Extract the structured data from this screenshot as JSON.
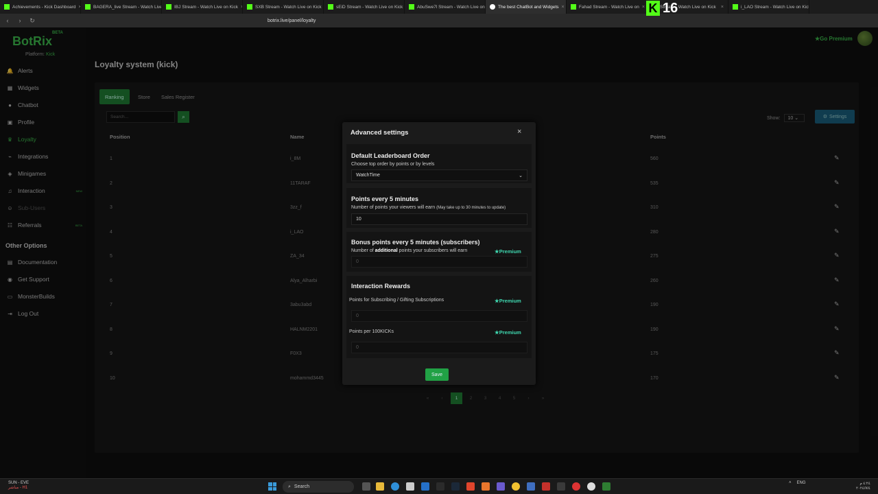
{
  "browser": {
    "tabs": [
      {
        "label": "Achievements - Kick Dashboard",
        "active": false
      },
      {
        "label": "BAGERA_live Stream - Watch Live",
        "active": false
      },
      {
        "label": "IBJ Stream - Watch Live on Kick",
        "active": false
      },
      {
        "label": "SXB Stream - Watch Live on Kick",
        "active": false
      },
      {
        "label": "sEiD Stream - Watch Live on Kick",
        "active": false
      },
      {
        "label": "AbuSwe7l Stream - Watch Live on",
        "active": false
      },
      {
        "label": "The best ChatBot and Widgets",
        "active": true
      },
      {
        "label": "Fahad Stream - Watch Live on",
        "active": false
      },
      {
        "label": "Stream - Watch Live on Kick",
        "active": false
      },
      {
        "label": "i_LAO Stream - Watch Live on Kick",
        "active": false
      }
    ],
    "url": "botrix.live/panel/loyalty",
    "overlay_badge": "16"
  },
  "app": {
    "logo": "BotRix",
    "logo_beta": "BETA",
    "platform_label": "Platform:",
    "platform_value": "Kick",
    "go_premium": "Go Premium",
    "nav": [
      {
        "label": "Alerts",
        "icon": "bell-icon",
        "state": "normal",
        "tag": ""
      },
      {
        "label": "Widgets",
        "icon": "widget-icon",
        "state": "normal",
        "tag": ""
      },
      {
        "label": "Chatbot",
        "icon": "chat-icon",
        "state": "normal",
        "tag": ""
      },
      {
        "label": "Profile",
        "icon": "profile-icon",
        "state": "normal",
        "tag": ""
      },
      {
        "label": "Loyalty",
        "icon": "trophy-icon",
        "state": "active",
        "tag": ""
      },
      {
        "label": "Integrations",
        "icon": "plug-icon",
        "state": "normal",
        "tag": ""
      },
      {
        "label": "Minigames",
        "icon": "gamepad-icon",
        "state": "normal",
        "tag": ""
      },
      {
        "label": "Interaction",
        "icon": "music-icon",
        "state": "normal",
        "tag": "NEW"
      },
      {
        "label": "Sub-Users",
        "icon": "users-icon",
        "state": "disabled",
        "tag": ""
      },
      {
        "label": "Referrals",
        "icon": "referral-icon",
        "state": "normal",
        "tag": "BETA"
      }
    ],
    "other_heading": "Other Options",
    "other": [
      {
        "label": "Documentation",
        "icon": "book-icon"
      },
      {
        "label": "Get Support",
        "icon": "support-icon"
      },
      {
        "label": "MonsterBuilds",
        "icon": "monitor-icon"
      },
      {
        "label": "Log Out",
        "icon": "logout-icon"
      }
    ]
  },
  "loyalty": {
    "title": "Loyalty system (kick)",
    "tabs": [
      "Ranking",
      "Store",
      "Sales Register"
    ],
    "search_placeholder": "Search...",
    "show_label": "Show:",
    "show_value": "10",
    "settings_label": "Settings",
    "columns": [
      "Position",
      "Name",
      "Points"
    ],
    "rows": [
      {
        "pos": "1",
        "name": "i_8M",
        "points": "560"
      },
      {
        "pos": "2",
        "name": "11TARAF",
        "points": "535"
      },
      {
        "pos": "3",
        "name": "3zz_f",
        "points": "310"
      },
      {
        "pos": "4",
        "name": "i_LAO",
        "points": "280"
      },
      {
        "pos": "5",
        "name": "ZA_34",
        "points": "275"
      },
      {
        "pos": "6",
        "name": "Alya_Alharbi",
        "points": "260"
      },
      {
        "pos": "7",
        "name": "3abu3abd",
        "points": "190"
      },
      {
        "pos": "8",
        "name": "HALNM2201",
        "points": "190"
      },
      {
        "pos": "9",
        "name": "F0X3",
        "points": "175"
      },
      {
        "pos": "10",
        "name": "mohammd3445",
        "points": "170"
      }
    ],
    "pagination": [
      "«",
      "‹",
      "1",
      "2",
      "3",
      "4",
      "5",
      "›",
      "»"
    ],
    "current_page": "1"
  },
  "modal": {
    "title": "Advanced settings",
    "close": "×",
    "leaderboard_heading": "Default Leaderboard Order",
    "leaderboard_desc": "Choose top order by points or by levels",
    "leaderboard_value": "WatchTime",
    "points_heading": "Points every 5 minutes",
    "points_desc": "Number of points your viewers will earn",
    "points_note": "(May take up to 30 minutes to update)",
    "points_value": "10",
    "bonus_heading": "Bonus points every 5 minutes (subscribers)",
    "bonus_desc_pre": "Number of",
    "bonus_desc_bold": "additional",
    "bonus_desc_post": "points your subscribers will earn",
    "bonus_value": "0",
    "premium_label": "Premium",
    "rewards_heading": "Interaction Rewards",
    "subs_label": "Points for Subscribing / Gifting Subscriptions",
    "subs_value": "0",
    "kicks_label": "Points per 100KICKs",
    "kicks_value": "0",
    "save_label": "Save"
  },
  "taskbar": {
    "weather_line1": "SUN - EVE",
    "weather_line2": "مباشر - H1",
    "search_label": "Search",
    "lang": "ENG",
    "time": "٤:٢٤ م",
    "date": "٢٠٢٤/٧/٤"
  }
}
